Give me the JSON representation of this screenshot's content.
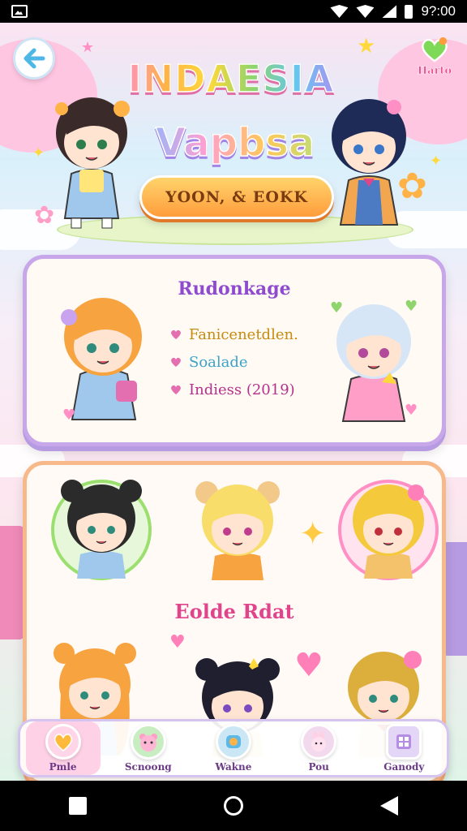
{
  "status_bar": {
    "time": "9?:00"
  },
  "header": {
    "title_line1": "INDAESIA",
    "title_line2": "Vapbsa",
    "main_button": "YOON, & EOKK",
    "corner_button_label": "Harto"
  },
  "profile_card": {
    "title": "Rudonkage",
    "items": [
      {
        "text": "Fanicenetdlen.",
        "color": "#c88a10"
      },
      {
        "text": "Soalade",
        "color": "#3aa3c9"
      },
      {
        "text": "Indiess (2019)",
        "color": "#b4318c"
      }
    ]
  },
  "gallery_card": {
    "title": "Eolde Rdat"
  },
  "bottom_nav": [
    {
      "label": "Pmle",
      "icon": "heart-icon",
      "color": "#ffd6e8"
    },
    {
      "label": "Scnoong",
      "icon": "bear-icon",
      "color": "#c7edc1"
    },
    {
      "label": "Wakne",
      "icon": "sticker-icon",
      "color": "#cbe7f6"
    },
    {
      "label": "Pou",
      "icon": "bunny-icon",
      "color": "#f3d9ee"
    },
    {
      "label": "Ganody",
      "icon": "grid-icon",
      "color": "#e3d6f7"
    }
  ],
  "colors": {
    "accent_pink": "#e0458c",
    "accent_purple": "#8f4bd0",
    "button_orange": "#ff9d3c"
  }
}
